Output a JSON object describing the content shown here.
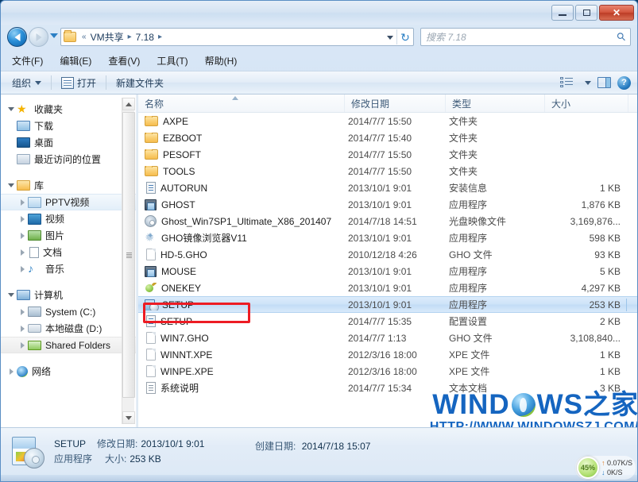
{
  "window": {
    "minimize_label": "最小化",
    "maximize_label": "最大化",
    "close_label": "✕"
  },
  "address": {
    "folder_icon": "folder-icon",
    "prefix": "«",
    "crumbs": [
      "VM共享",
      "7.18"
    ],
    "separator": "▸",
    "refresh_icon": "refresh-icon"
  },
  "search": {
    "placeholder": "搜索 7.18",
    "icon": "search-icon"
  },
  "menu": {
    "items": [
      {
        "label": "文件(F)"
      },
      {
        "label": "编辑(E)"
      },
      {
        "label": "查看(V)"
      },
      {
        "label": "工具(T)"
      },
      {
        "label": "帮助(H)"
      }
    ]
  },
  "toolbar": {
    "organize_label": "组织",
    "open_label": "打开",
    "new_folder_label": "新建文件夹",
    "view_icon": "list-view-icon",
    "pane_icon": "preview-pane-icon",
    "help_icon": "help-icon"
  },
  "sidebar": {
    "groups": [
      {
        "header": {
          "label": "收藏夹",
          "icon": "star-icon"
        },
        "items": [
          {
            "label": "下载",
            "icon": "downloads-icon",
            "selected": false
          },
          {
            "label": "桌面",
            "icon": "desktop-icon",
            "selected": false
          },
          {
            "label": "最近访问的位置",
            "icon": "recent-places-icon",
            "selected": false
          }
        ]
      },
      {
        "header": {
          "label": "库",
          "icon": "library-icon"
        },
        "items": [
          {
            "label": "PPTV视频",
            "icon": "library-folder-icon",
            "selected": true
          },
          {
            "label": "视频",
            "icon": "videos-icon",
            "selected": false
          },
          {
            "label": "图片",
            "icon": "pictures-icon",
            "selected": false
          },
          {
            "label": "文档",
            "icon": "documents-icon",
            "selected": false
          },
          {
            "label": "音乐",
            "icon": "music-icon",
            "selected": false
          }
        ]
      },
      {
        "header": {
          "label": "计算机",
          "icon": "computer-icon"
        },
        "items": [
          {
            "label": "System (C:)",
            "icon": "system-drive-icon",
            "selected": false
          },
          {
            "label": "本地磁盘 (D:)",
            "icon": "local-drive-icon",
            "selected": false
          },
          {
            "label": "Shared Folders",
            "icon": "network-drive-icon",
            "selected": true
          }
        ]
      },
      {
        "header": {
          "label": "网络",
          "icon": "network-icon"
        },
        "items": []
      }
    ]
  },
  "filelist": {
    "columns": [
      {
        "label": "名称",
        "key": "name"
      },
      {
        "label": "修改日期",
        "key": "date"
      },
      {
        "label": "类型",
        "key": "type"
      },
      {
        "label": "大小",
        "key": "size"
      }
    ],
    "sort_column": "名称",
    "sort_direction": "ascending",
    "rows": [
      {
        "name": "AXPE",
        "date": "2014/7/7 15:50",
        "type": "文件夹",
        "size": "",
        "icon": "folder-icon",
        "selected": false
      },
      {
        "name": "EZBOOT",
        "date": "2014/7/7 15:40",
        "type": "文件夹",
        "size": "",
        "icon": "folder-icon",
        "selected": false
      },
      {
        "name": "PESOFT",
        "date": "2014/7/7 15:50",
        "type": "文件夹",
        "size": "",
        "icon": "folder-icon",
        "selected": false
      },
      {
        "name": "TOOLS",
        "date": "2014/7/7 15:50",
        "type": "文件夹",
        "size": "",
        "icon": "folder-icon",
        "selected": false
      },
      {
        "name": "AUTORUN",
        "date": "2013/10/1 9:01",
        "type": "安装信息",
        "size": "1 KB",
        "icon": "setup-information-icon",
        "selected": false
      },
      {
        "name": "GHOST",
        "date": "2013/10/1 9:01",
        "type": "应用程序",
        "size": "1,876 KB",
        "icon": "application-icon",
        "selected": false
      },
      {
        "name": "Ghost_Win7SP1_Ultimate_X86_201407",
        "date": "2014/7/18 14:51",
        "type": "光盘映像文件",
        "size": "3,169,876...",
        "icon": "disc-image-icon",
        "selected": false
      },
      {
        "name": "GHO镜像浏览器V11",
        "date": "2013/10/1 9:01",
        "type": "应用程序",
        "size": "598 KB",
        "icon": "gho-browser-icon",
        "selected": false
      },
      {
        "name": "HD-5.GHO",
        "date": "2010/12/18 4:26",
        "type": "GHO 文件",
        "size": "93 KB",
        "icon": "generic-file-icon",
        "selected": false
      },
      {
        "name": "MOUSE",
        "date": "2013/10/1 9:01",
        "type": "应用程序",
        "size": "5 KB",
        "icon": "application-icon",
        "selected": false
      },
      {
        "name": "ONEKEY",
        "date": "2013/10/1 9:01",
        "type": "应用程序",
        "size": "4,297 KB",
        "icon": "onekey-icon",
        "selected": false
      },
      {
        "name": "SETUP",
        "date": "2013/10/1 9:01",
        "type": "应用程序",
        "size": "253 KB",
        "icon": "setup-application-icon",
        "selected": true
      },
      {
        "name": "SETUP",
        "date": "2014/7/7 15:35",
        "type": "配置设置",
        "size": "2 KB",
        "icon": "setup-information-icon",
        "selected": false
      },
      {
        "name": "WIN7.GHO",
        "date": "2014/7/7 1:13",
        "type": "GHO 文件",
        "size": "3,108,840...",
        "icon": "generic-file-icon",
        "selected": false
      },
      {
        "name": "WINNT.XPE",
        "date": "2012/3/16 18:00",
        "type": "XPE 文件",
        "size": "1 KB",
        "icon": "generic-file-icon",
        "selected": false
      },
      {
        "name": "WINPE.XPE",
        "date": "2012/3/16 18:00",
        "type": "XPE 文件",
        "size": "1 KB",
        "icon": "generic-file-icon",
        "selected": false
      },
      {
        "name": "系统说明",
        "date": "2014/7/7 15:34",
        "type": "文本文档",
        "size": "3 KB",
        "icon": "text-document-icon",
        "selected": false
      }
    ]
  },
  "details": {
    "name": "SETUP",
    "modified_label": "修改日期:",
    "modified_value": "2013/10/1 9:01",
    "created_label": "创建日期:",
    "created_value": "2014/7/18 15:07",
    "type_value": "应用程序",
    "size_label": "大小:",
    "size_value": "253 KB",
    "icon": "setup-application-large-icon"
  },
  "watermark": {
    "brand_left": "WIND",
    "brand_right": "WS",
    "brand_cn": "之家",
    "url": "HTTP://WWW.WINDOWSZJ.COM/"
  },
  "net_widget": {
    "percent": "45%",
    "upload": "0.07K/S",
    "download": "0K/S",
    "up_arrow": "↑",
    "down_arrow": "↓"
  },
  "colors": {
    "accent": "#2a7fc4",
    "highlight_box": "#ed1c24",
    "selection": "#cde3f8",
    "watermark": "#1565c0"
  }
}
